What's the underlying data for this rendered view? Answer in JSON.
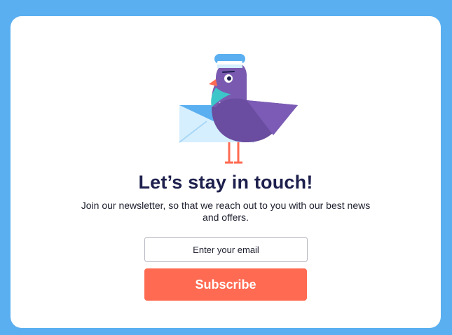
{
  "newsletter": {
    "title": "Let’s stay in touch!",
    "subtitle": "Join our newsletter, so that we reach out to you with our best news and offers.",
    "email_placeholder": "Enter your email",
    "subscribe_label": "Subscribe"
  },
  "illustration": {
    "icon": "pigeon-mail-carrier-illustration"
  },
  "colors": {
    "background": "#5aaff0",
    "card": "#ffffff",
    "title": "#1d1f4d",
    "button": "#ff6b52",
    "button_text": "#ffffff"
  }
}
